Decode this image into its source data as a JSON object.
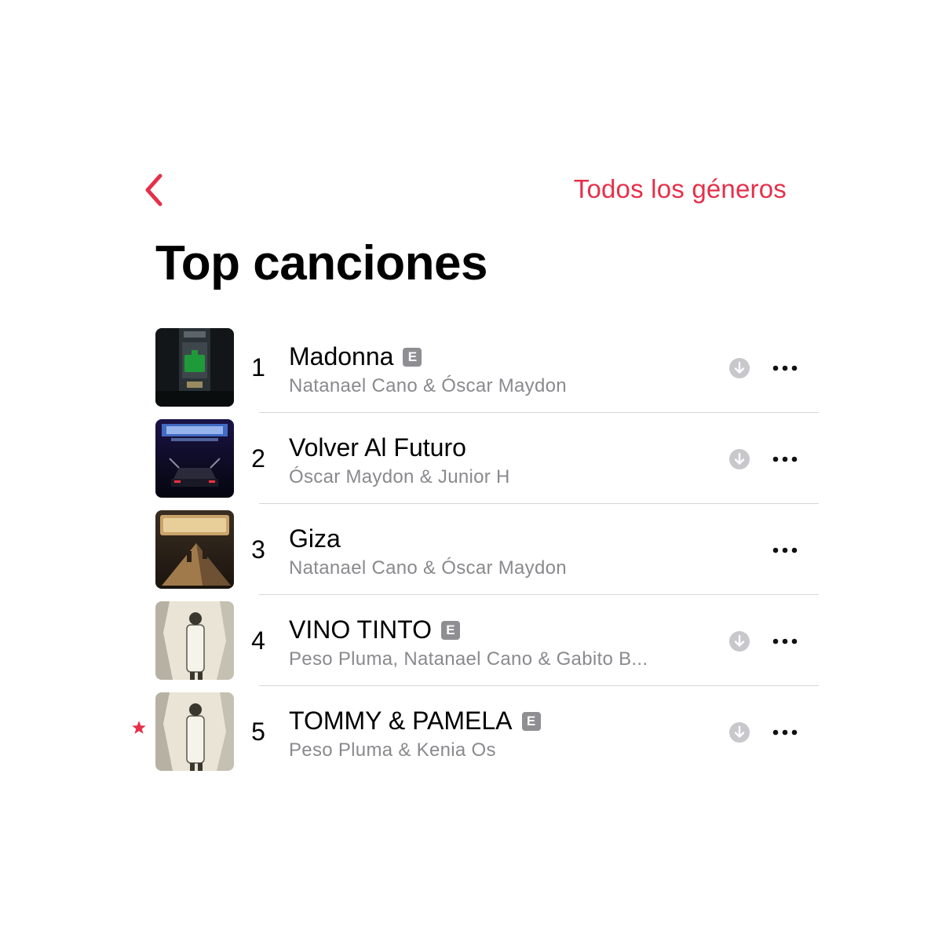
{
  "nav": {
    "back_icon": "chevron-left-icon",
    "genres_label": "Todos los géneros",
    "accent_color": "#e5304a"
  },
  "page": {
    "title": "Top canciones"
  },
  "songs": [
    {
      "rank": "1",
      "title": "Madonna",
      "explicit": true,
      "explicit_label": "E",
      "artist": "Natanael Cano & Óscar Maydon",
      "download": true,
      "starred": false
    },
    {
      "rank": "2",
      "title": "Volver Al Futuro",
      "explicit": false,
      "artist": "Óscar Maydon & Junior H",
      "download": true,
      "starred": false
    },
    {
      "rank": "3",
      "title": "Giza",
      "explicit": false,
      "artist": "Natanael Cano & Óscar Maydon",
      "download": false,
      "starred": false
    },
    {
      "rank": "4",
      "title": "VINO TINTO",
      "explicit": true,
      "explicit_label": "E",
      "artist": "Peso Pluma, Natanael Cano & Gabito B...",
      "download": true,
      "starred": false
    },
    {
      "rank": "5",
      "title": "TOMMY & PAMELA",
      "explicit": true,
      "explicit_label": "E",
      "artist": "Peso Pluma & Kenia Os",
      "download": true,
      "starred": true
    }
  ]
}
